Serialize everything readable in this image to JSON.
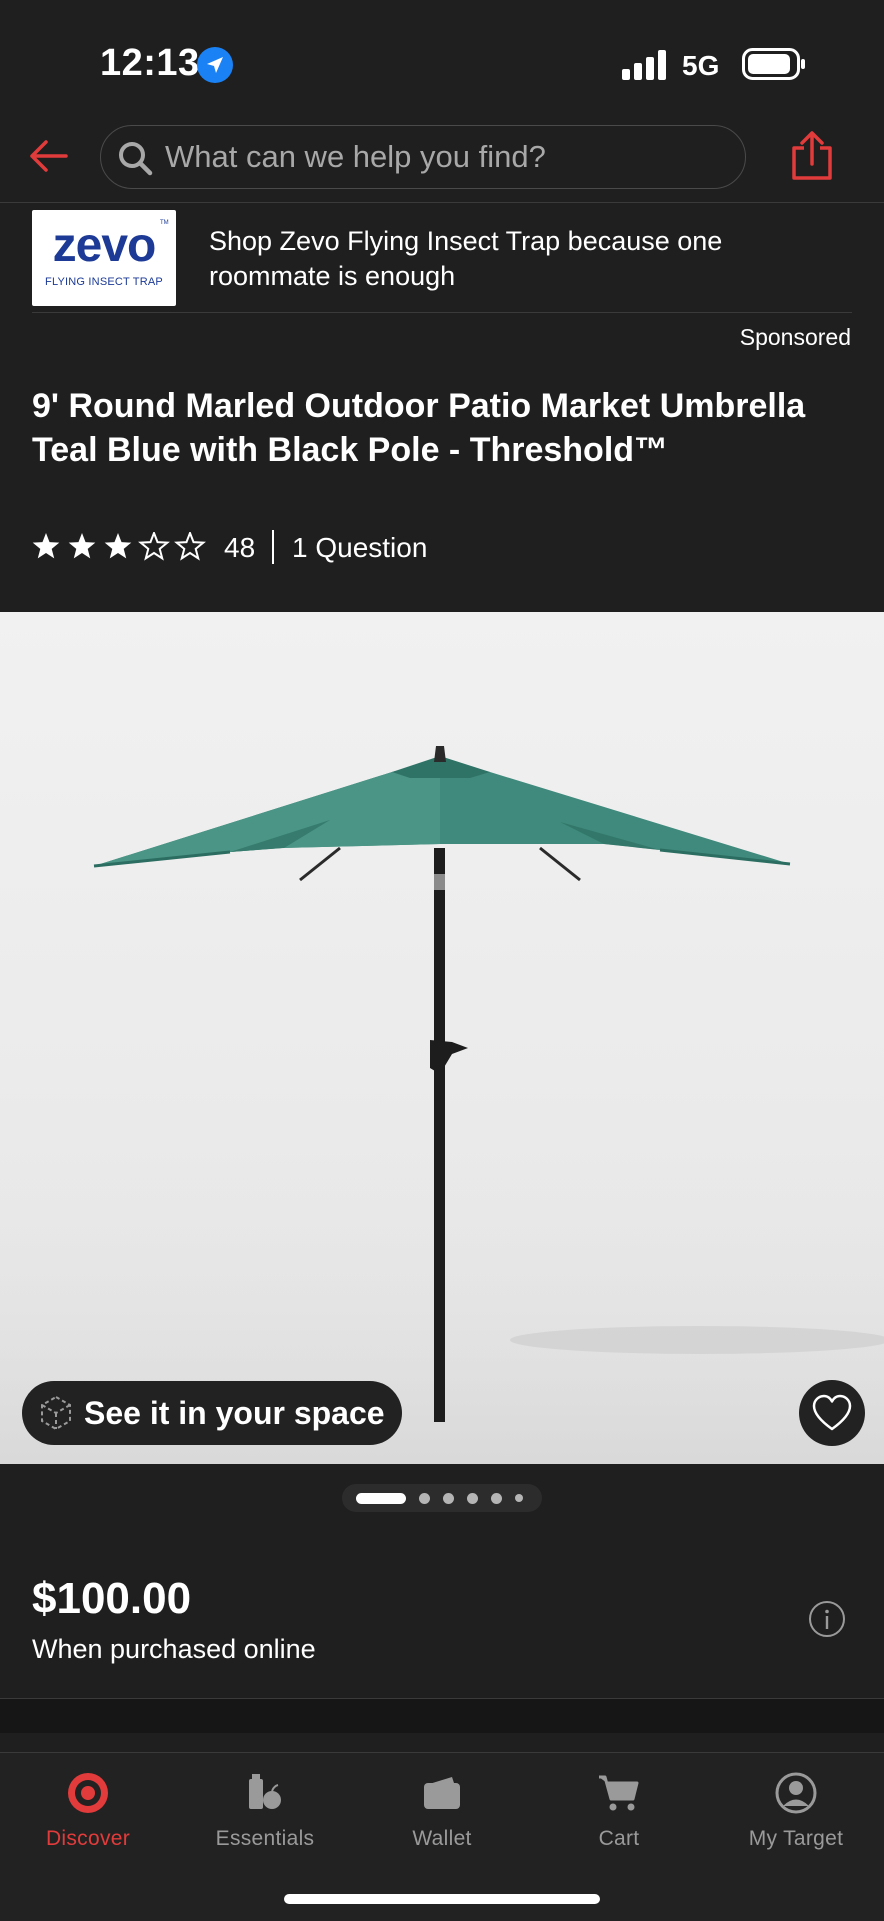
{
  "status_bar": {
    "time": "12:13",
    "network": "5G",
    "icons": [
      "location-arrow-icon",
      "signal-bars-icon",
      "battery-icon"
    ]
  },
  "header": {
    "search_placeholder": "What can we help you find?",
    "icons": [
      "back-arrow-icon",
      "search-icon",
      "share-icon"
    ],
    "accent_color": "#e23b3b"
  },
  "ad": {
    "brand_logo_text": "zevo",
    "brand_logo_subtext": "FLYING INSECT TRAP",
    "brand_logo_tm": "TM",
    "text": "Shop Zevo Flying Insect Trap because one roommate is enough",
    "sponsored_label": "Sponsored",
    "logo_color": "#1c3a96"
  },
  "product": {
    "title": "9' Round Marled Outdoor Patio Market Umbrella Teal Blue with Black Pole - Threshold™",
    "rating": 3.5,
    "rating_max": 5,
    "review_count": "48",
    "questions": "1 Question",
    "ar_button_label": "See it in your space",
    "image_count": 6,
    "active_image_index": 0,
    "umbrella_color": "#3f8a7c",
    "price": "$100.00",
    "price_note": "When purchased online"
  },
  "tab_bar": {
    "tabs": [
      {
        "label": "Discover",
        "icon": "target-bullseye-icon",
        "active": true
      },
      {
        "label": "Essentials",
        "icon": "essentials-grocery-icon",
        "active": false
      },
      {
        "label": "Wallet",
        "icon": "wallet-icon",
        "active": false
      },
      {
        "label": "Cart",
        "icon": "cart-icon",
        "active": false
      },
      {
        "label": "My Target",
        "icon": "user-profile-icon",
        "active": false
      }
    ]
  }
}
